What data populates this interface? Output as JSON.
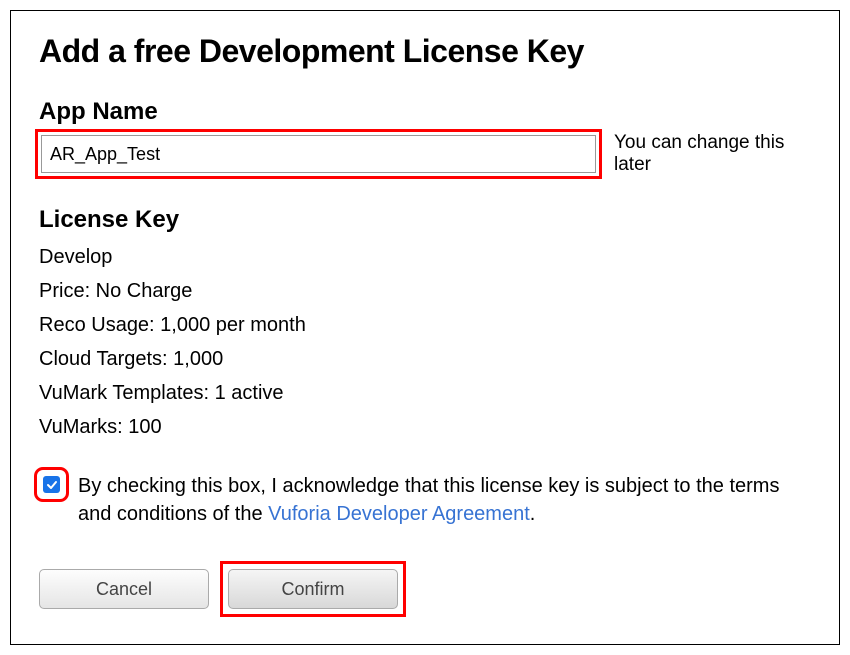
{
  "title": "Add a free Development License Key",
  "app_name": {
    "label": "App Name",
    "value": "AR_App_Test",
    "hint": "You can change this later"
  },
  "license": {
    "label": "License Key",
    "items": [
      "Develop",
      "Price: No Charge",
      "Reco Usage: 1,000 per month",
      "Cloud Targets: 1,000",
      "VuMark Templates: 1 active",
      "VuMarks: 100"
    ]
  },
  "agreement": {
    "checked": true,
    "text_pre": "By checking this box, I acknowledge that this license key is subject to the terms and conditions of the ",
    "link_text": "Vuforia Developer Agreement",
    "text_post": "."
  },
  "buttons": {
    "cancel": "Cancel",
    "confirm": "Confirm"
  }
}
